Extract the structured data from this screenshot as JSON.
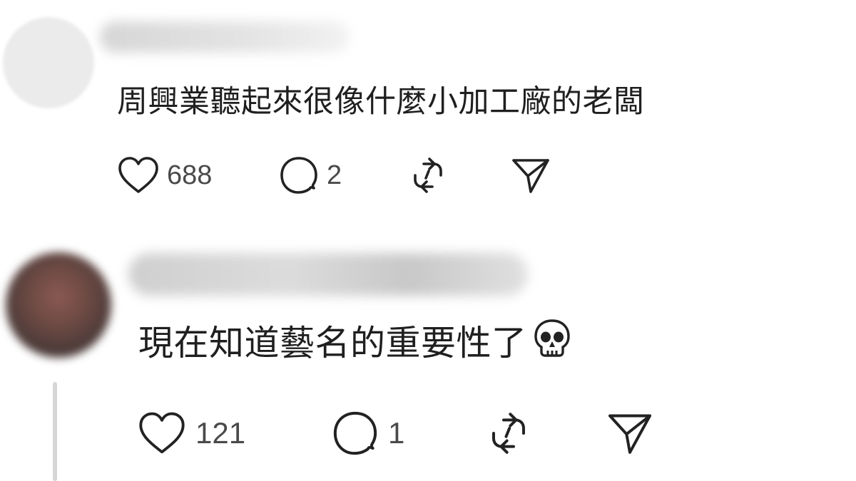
{
  "comments": [
    {
      "text": "周興業聽起來很像什麼小加工廠的老闆",
      "likes": "688",
      "replies": "2"
    },
    {
      "text": "現在知道藝名的重要性了",
      "emoji": "skull-emoji",
      "likes": "121",
      "replies": "1"
    }
  ],
  "icons": {
    "like": "heart-icon",
    "reply": "speech-bubble-icon",
    "repost": "repost-icon",
    "share": "send-icon"
  }
}
